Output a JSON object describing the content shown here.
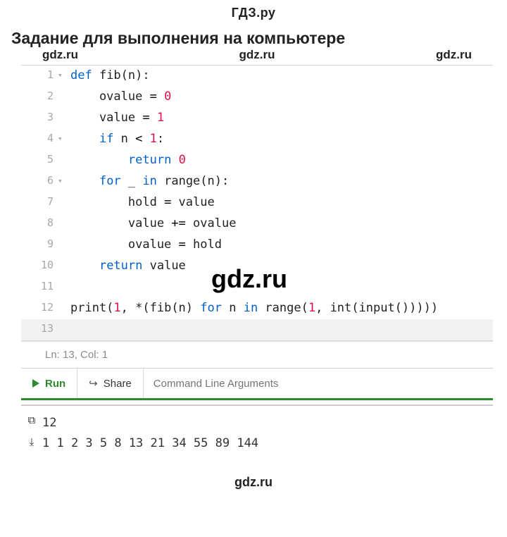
{
  "brand_top": "ГДЗ.ру",
  "heading": "Задание для выполнения на компьютере",
  "watermarks": {
    "w1": "gdz.ru",
    "w2": "gdz.ru",
    "w3": "gdz.ru",
    "big": "gdz.ru",
    "bottom": "gdz.ru"
  },
  "code": {
    "l1": "def fib(n):",
    "l2": "    ovalue = 0",
    "l3": "    value = 1",
    "l4": "    if n < 1:",
    "l5": "        return 0",
    "l6": "    for _ in range(n):",
    "l7": "        hold = value",
    "l8": "        value += ovalue",
    "l9": "        ovalue = hold",
    "l10": "    return value",
    "l11": "",
    "l12": "print(1, *(fib(n) for n in range(1, int(input()))))",
    "l13": ""
  },
  "lines": {
    "n1": "1",
    "n2": "2",
    "n3": "3",
    "n4": "4",
    "n5": "5",
    "n6": "6",
    "n7": "7",
    "n8": "8",
    "n9": "9",
    "n10": "10",
    "n11": "11",
    "n12": "12",
    "n13": "13"
  },
  "status": "Ln: 13,  Col: 1",
  "toolbar": {
    "run": "Run",
    "share": "Share",
    "cli_placeholder": "Command Line Arguments"
  },
  "output": {
    "in": "12",
    "out": "1 1 2 3 5 8 13 21 34 55 89 144"
  },
  "icons": {
    "copy": "copy-icon",
    "download": "download-icon",
    "share": "share-icon",
    "play": "play-icon"
  }
}
